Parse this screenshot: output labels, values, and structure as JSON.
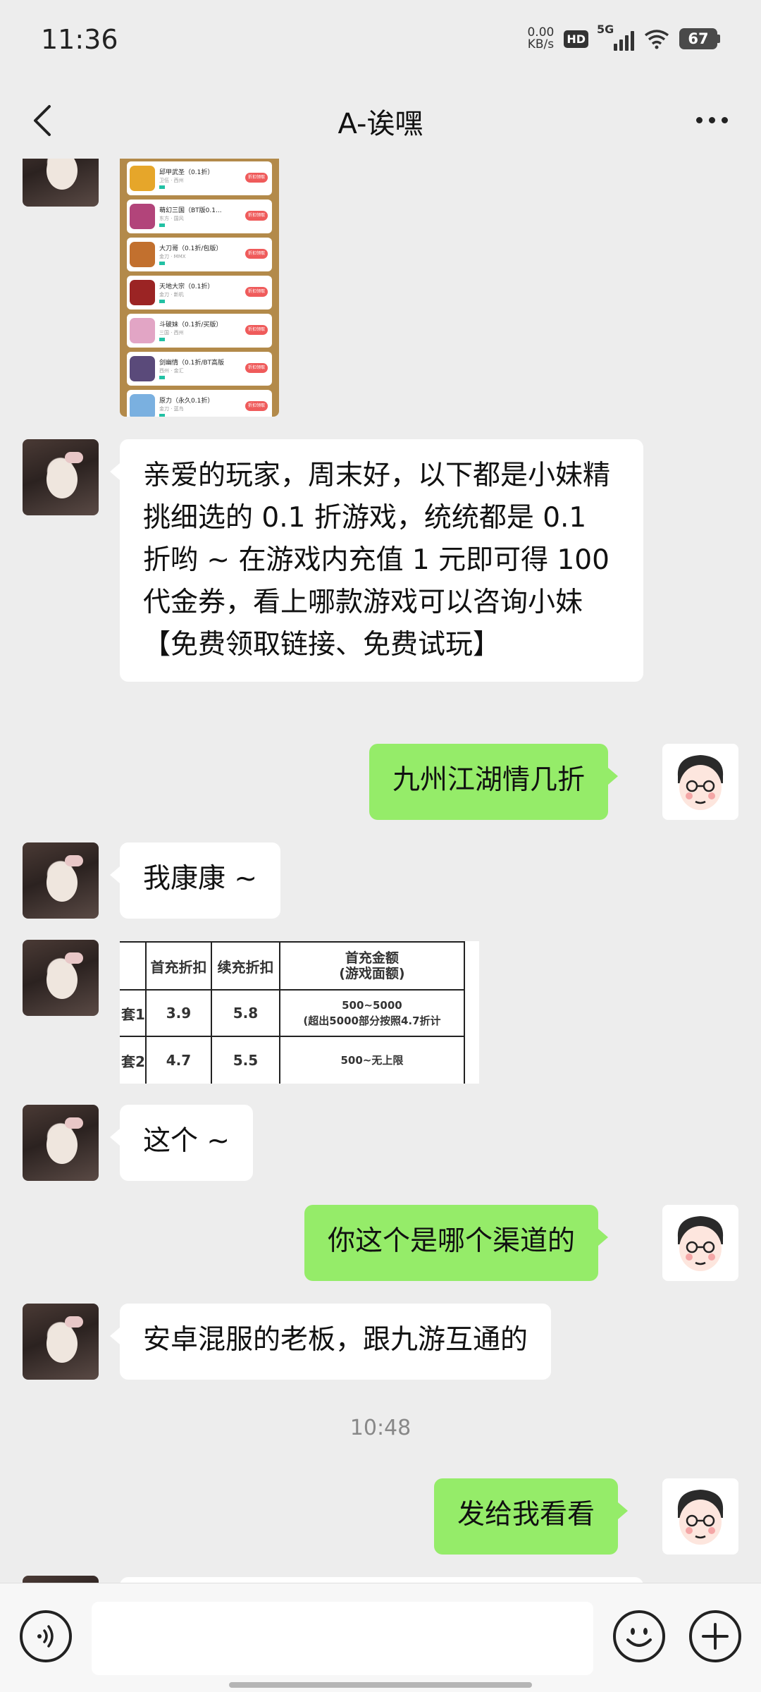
{
  "status_bar": {
    "time": "11:36",
    "net_speed": "0.00",
    "net_unit": "KB/s",
    "hd": "HD",
    "network": "5G",
    "battery": "67"
  },
  "header": {
    "title": "A-诶嘿",
    "back_icon": "chevron-left-icon",
    "more_icon": "more-dots-icon"
  },
  "games": [
    {
      "name": "邱甲武圣（0.1折）",
      "sub": "卫伍 · 西州",
      "btn": "折扣领取",
      "color": "#e6a62a"
    },
    {
      "name": "萌幻三国（BT版0.1...",
      "sub": "东方 · 国风",
      "btn": "折扣领取",
      "color": "#b2447a"
    },
    {
      "name": "大刀哥（0.1折/包版）",
      "sub": "金刀 · MMX",
      "btn": "折扣领取",
      "color": "#c2702e"
    },
    {
      "name": "天地大宗（0.1折）",
      "sub": "金刀 · 新机",
      "btn": "折扣领取",
      "color": "#9b2424"
    },
    {
      "name": "斗破妹（0.1折/买版）",
      "sub": "三国 · 西州",
      "btn": "折扣领取",
      "color": "#e2a5c5"
    },
    {
      "name": "剑幽情（0.1折/BT高版",
      "sub": "西州 · 金汇",
      "btn": "折扣领取",
      "color": "#5a4a7a"
    },
    {
      "name": "原力（永久0.1折）",
      "sub": "金刀 · 蓝鸟",
      "btn": "折扣领取",
      "color": "#7ab0e0"
    }
  ],
  "messages": {
    "m1": "亲爱的玩家，周末好，以下都是小妹精挑细选的 0.1 折游戏，统统都是 0.1 折哟 ~ 在游戏内充值 1 元即可得 100 代金券，看上哪款游戏可以咨询小妹【免费领取链接、免费试玩】",
    "m2": "九州江湖情几折",
    "m3": "我康康 ~",
    "m4": "这个 ~",
    "m5": "你这个是哪个渠道的",
    "m6": "安卓混服的老板，跟九游互通的",
    "timestamp": "10:48",
    "m7": "发给我看看"
  },
  "table": {
    "headers": [
      "首充折扣",
      "续充折扣",
      "首充金额",
      "(游戏面额)"
    ],
    "rows": [
      {
        "label": "套1",
        "first": "3.9",
        "renew": "5.8",
        "amount": "500~5000",
        "note": "(超出5000部分按照4.7折计"
      },
      {
        "label": "套2",
        "first": "4.7",
        "renew": "5.5",
        "amount": "500~无上限",
        "note": ""
      }
    ]
  },
  "input_bar": {
    "voice_icon": "voice-icon",
    "emoji_icon": "emoji-icon",
    "plus_icon": "plus-icon"
  }
}
